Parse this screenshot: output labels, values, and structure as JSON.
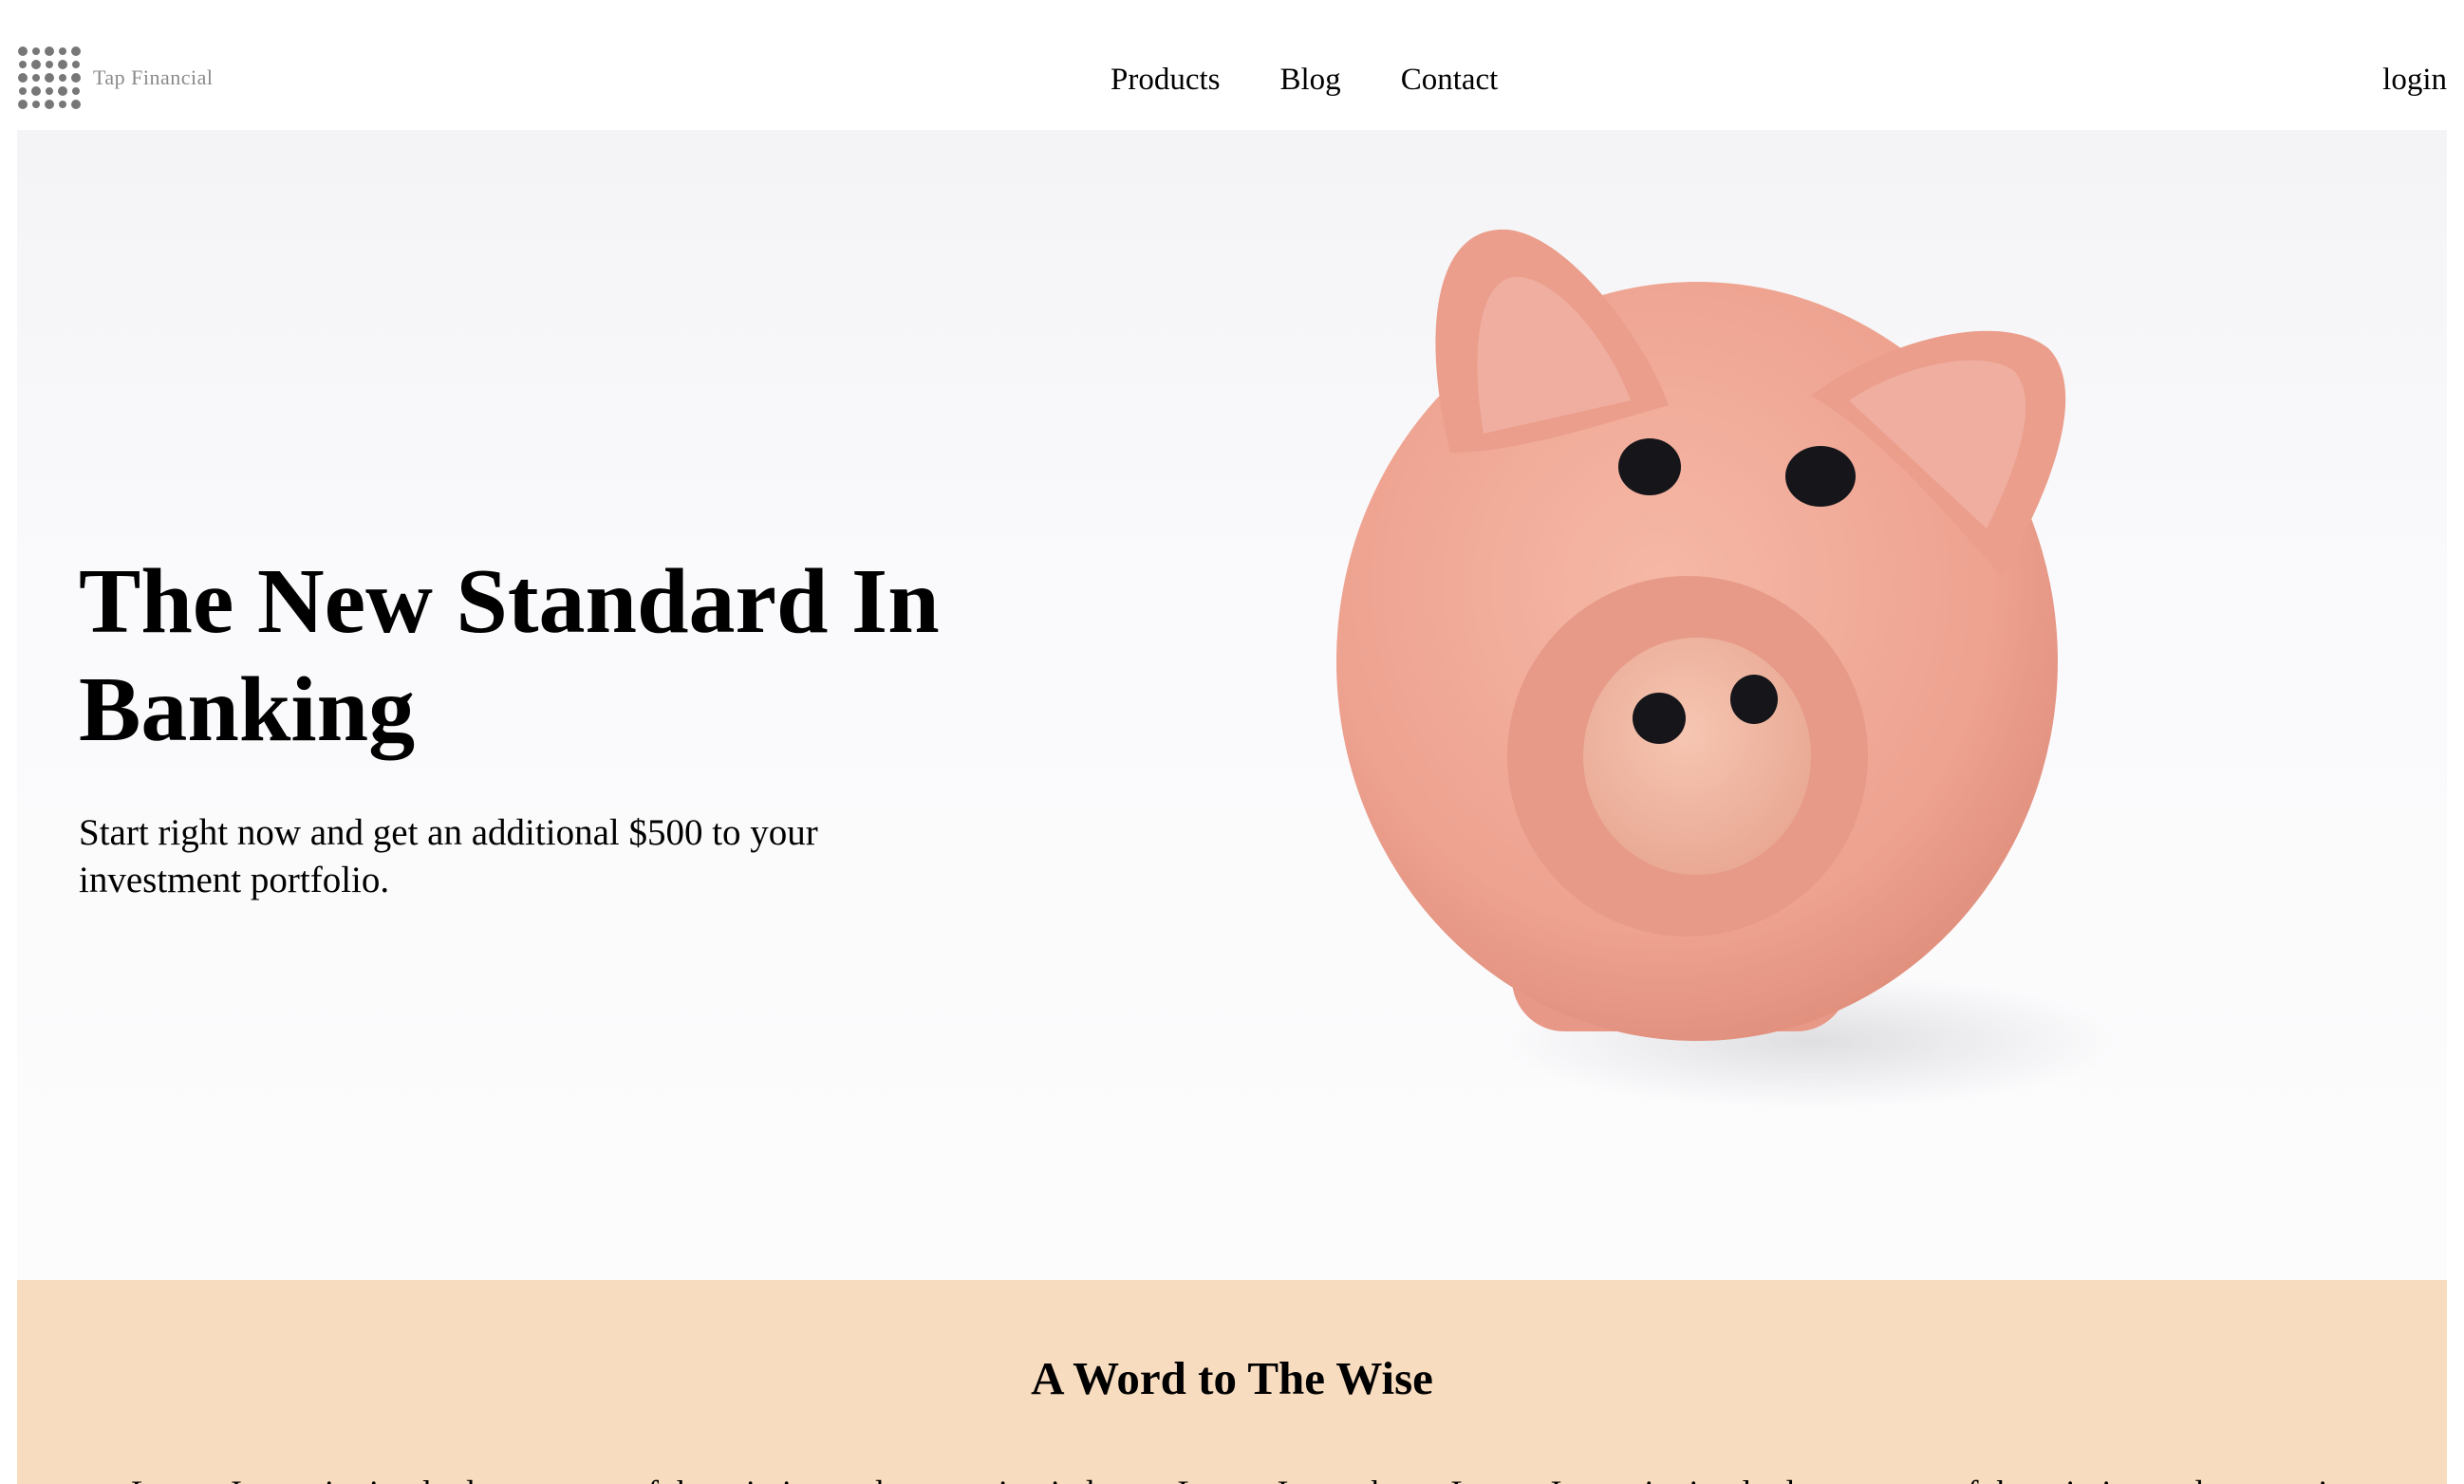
{
  "header": {
    "logo_text": "Tap Financial",
    "nav": [
      {
        "label": "Products"
      },
      {
        "label": "Blog"
      },
      {
        "label": "Contact"
      }
    ],
    "login_label": "login"
  },
  "hero": {
    "title": "The New Standard In Banking",
    "subtitle": "Start right now and get an additional $500 to your investment portfolio.",
    "image_icon": "piggy-bank"
  },
  "section": {
    "title": "A Word to The Wise",
    "body": "Lorem Ipsum is simply dummy text of the printing and typesetting industry. Lorem Ipsum has... Lorem Ipsum is simply dummy text of the printing and typesetting industry. Lorem"
  },
  "colors": {
    "section_background": "#f8dcbf",
    "piggy_pink": "#f0a898",
    "logo_gray": "#8a8a8a"
  }
}
